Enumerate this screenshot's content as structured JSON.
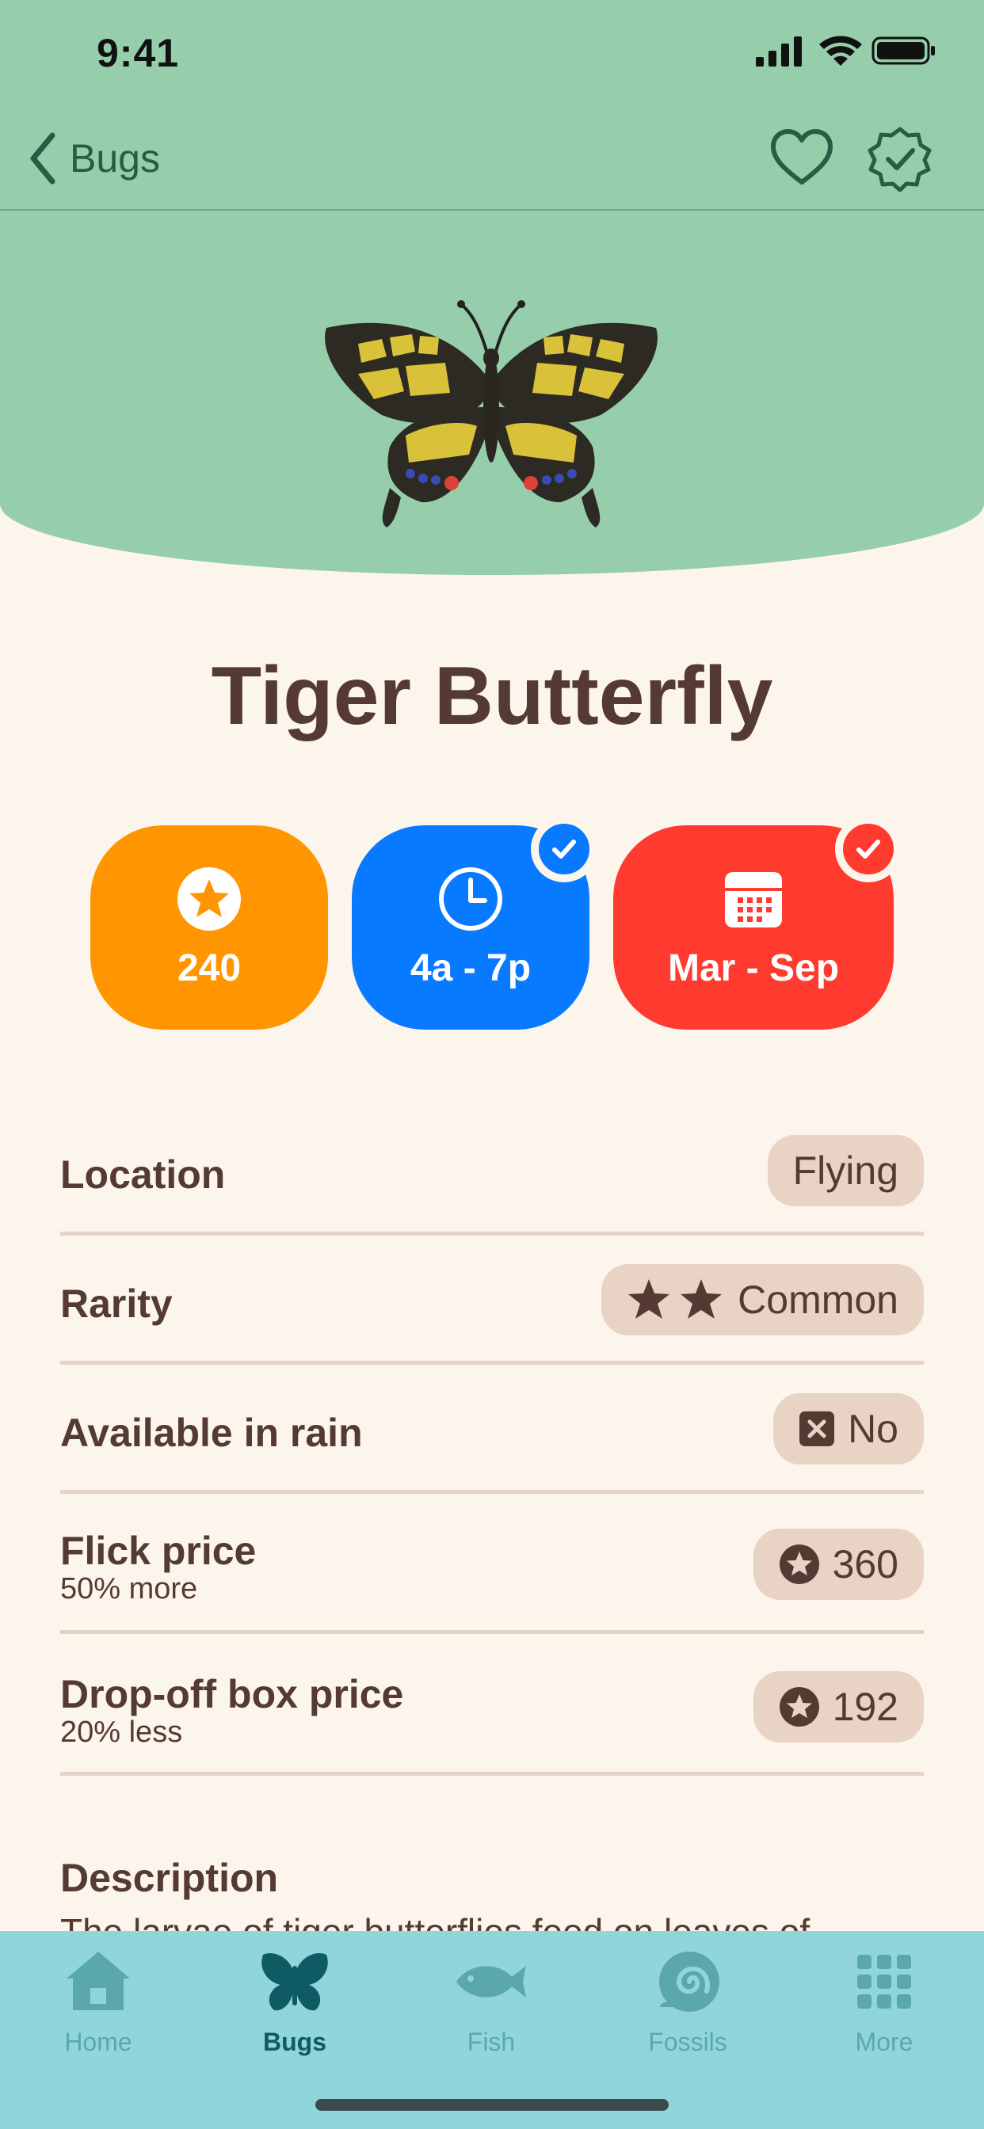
{
  "status_bar": {
    "time": "9:41"
  },
  "nav": {
    "back_label": "Bugs",
    "favorite_icon": "heart-icon",
    "donate_icon": "checkmark-seal-icon"
  },
  "critter": {
    "name": "Tiger Butterfly",
    "image_icon": "butterfly-illustration"
  },
  "stats": {
    "price": {
      "label": "240",
      "icon": "star-circle-icon",
      "color": "#ff9500"
    },
    "time": {
      "label": "4a - 7p",
      "icon": "clock-icon",
      "color": "#087aff",
      "checked": true
    },
    "season": {
      "label": "Mar - Sep",
      "icon": "calendar-icon",
      "color": "#ff3a2f",
      "checked": true
    }
  },
  "rows": {
    "location": {
      "title": "Location",
      "value": "Flying"
    },
    "rarity": {
      "title": "Rarity",
      "value": "Common",
      "stars": 2
    },
    "rain": {
      "title": "Available in rain",
      "value": "No"
    },
    "flick": {
      "title": "Flick price",
      "subtitle": "50% more",
      "value": "360"
    },
    "dropoff": {
      "title": "Drop-off box price",
      "subtitle": "20% less",
      "value": "192"
    }
  },
  "description": {
    "title": "Description",
    "text": "The larvae of tiger butterflies feed on leaves of"
  },
  "tabs": [
    {
      "label": "Home",
      "icon": "house-icon"
    },
    {
      "label": "Bugs",
      "icon": "butterfly-icon",
      "active": true
    },
    {
      "label": "Fish",
      "icon": "fish-icon"
    },
    {
      "label": "Fossils",
      "icon": "fossil-shell-icon"
    },
    {
      "label": "More",
      "icon": "grid-icon"
    }
  ],
  "colors": {
    "header_green": "#96ceac",
    "background_cream": "#fcf5ec",
    "text_brown": "#553a34",
    "pill_bg": "#e9d3c5",
    "tab_bar_teal": "#8fd5da"
  }
}
